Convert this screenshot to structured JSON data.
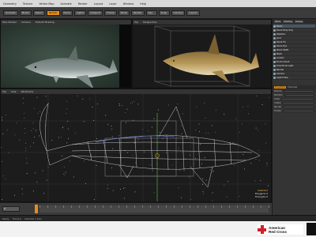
{
  "menu": [
    "Geometry",
    "Texture",
    "Vertex Map",
    "Animate",
    "Render",
    "Layout",
    "Layer",
    "Window",
    "Help"
  ],
  "toolbar": [
    "Animate",
    "Model",
    "Select",
    "Render",
    "Items",
    "Lights",
    "Viewport",
    "Frame",
    "Mode",
    "Render",
    "Key",
    "Snap",
    "Camera",
    "Layout"
  ],
  "toolbar_active_index": 3,
  "viewports": {
    "camera": {
      "tabs": [
        "Pers Shader",
        "Camera",
        "Default Shading"
      ],
      "hint": "Pers Camera"
    },
    "perspective": {
      "tabs": [
        "Top",
        "Perspective"
      ]
    },
    "side": {
      "tabs": [
        "Top",
        "Side",
        "Wireframe"
      ],
      "info": [
        "Selected",
        "Polygons 0",
        "Triangles 0"
      ]
    }
  },
  "items": {
    "tabs": [
      "Items",
      "Shading",
      "Groups"
    ],
    "tree": [
      {
        "label": "Shark",
        "selected": true
      },
      {
        "label": "Shark Body Poly",
        "selected": false
      },
      {
        "label": "Skeleton",
        "selected": false
      },
      {
        "label": "Joint",
        "selected": false
      },
      {
        "label": "Shark Fin",
        "selected": false
      },
      {
        "label": "Shark Eye",
        "selected": false
      },
      {
        "label": "Shark Teeth",
        "selected": false
      },
      {
        "label": "Mesh",
        "selected": false
      },
      {
        "label": "Locator",
        "selected": false
      },
      {
        "label": "Environment",
        "selected": false
      },
      {
        "label": "Directional Light",
        "selected": false
      },
      {
        "label": "Render",
        "selected": false
      },
      {
        "label": "Camera",
        "selected": false
      },
      {
        "label": "Light Probe",
        "selected": false
      }
    ]
  },
  "properties": {
    "tabs": [
      "Properties",
      "Channels"
    ],
    "rows": [
      "Position",
      "Rotation",
      "Scale",
      "Visible",
      "Render",
      "Enable"
    ]
  },
  "timeline": {
    "frame": "0"
  },
  "status": [
    "Ready",
    "Frame 0",
    "Selected 1 item"
  ],
  "ad": {
    "brand_line1": "American",
    "brand_line2": "Red Cross"
  },
  "colors": {
    "accent": "#e98c18",
    "wire": "#d9d9d9",
    "grid_highlight": "#4d9a3c"
  }
}
